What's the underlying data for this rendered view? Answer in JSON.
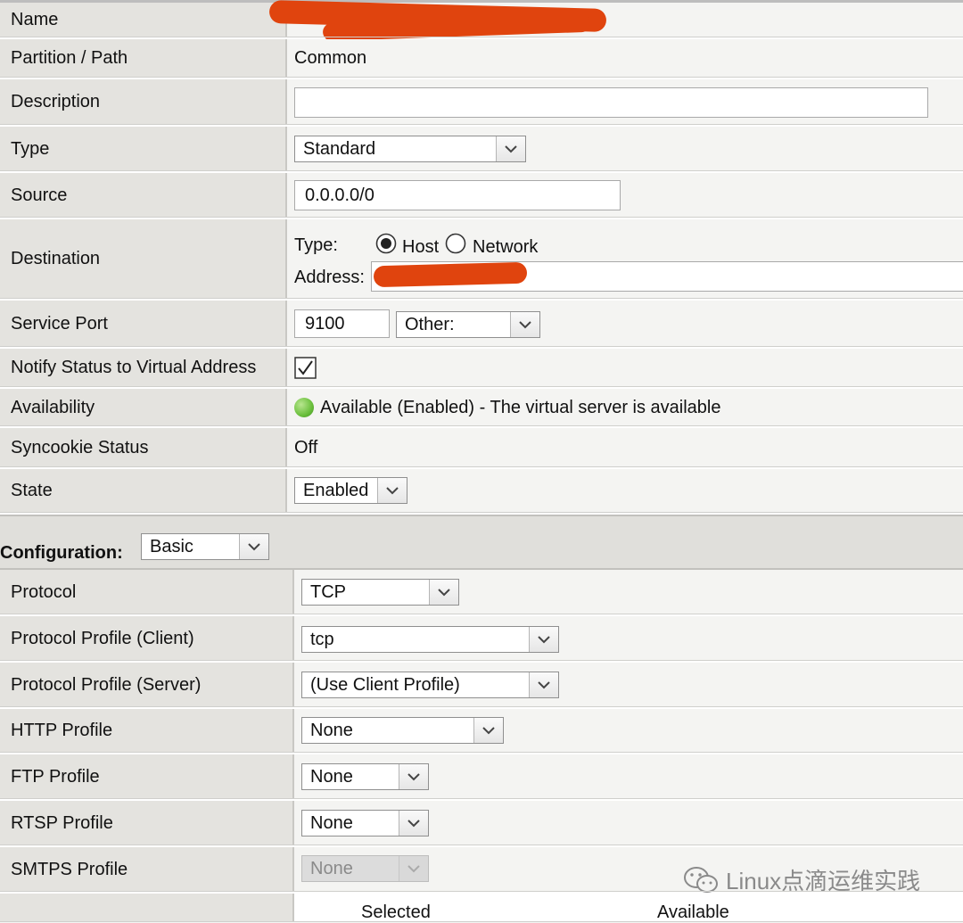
{
  "rows": {
    "name": {
      "label": "Name"
    },
    "partition": {
      "label": "Partition / Path",
      "value": "Common"
    },
    "description": {
      "label": "Description",
      "value": ""
    },
    "type": {
      "label": "Type",
      "value": "Standard"
    },
    "source": {
      "label": "Source",
      "value": "0.0.0.0/0"
    },
    "destination": {
      "label": "Destination",
      "type_label": "Type:",
      "option_host": "Host",
      "option_network": "Network",
      "selected": "Host",
      "address_label": "Address:"
    },
    "service_port": {
      "label": "Service Port",
      "port": "9100",
      "port_select": "Other:"
    },
    "notify": {
      "label": "Notify Status to Virtual Address",
      "checked": true
    },
    "availability": {
      "label": "Availability",
      "value": "Available (Enabled) - The virtual server is available",
      "status_color": "#6abf3c"
    },
    "syncookie": {
      "label": "Syncookie Status",
      "value": "Off"
    },
    "state": {
      "label": "State",
      "value": "Enabled"
    }
  },
  "configuration": {
    "label": "Configuration:",
    "value": "Basic"
  },
  "config_rows": {
    "protocol": {
      "label": "Protocol",
      "value": "TCP"
    },
    "client_profile": {
      "label": "Protocol Profile (Client)",
      "value": "tcp"
    },
    "server_profile": {
      "label": "Protocol Profile (Server)",
      "value": "(Use Client Profile)"
    },
    "http_profile": {
      "label": "HTTP Profile",
      "value": "None"
    },
    "ftp_profile": {
      "label": "FTP Profile",
      "value": "None"
    },
    "rtsp_profile": {
      "label": "RTSP Profile",
      "value": "None"
    },
    "smtps_profile": {
      "label": "SMTPS Profile",
      "value": "None",
      "disabled": true
    }
  },
  "ssl_lists": {
    "selected_header": "Selected",
    "available_header": "Available"
  },
  "watermark": {
    "text": "Linux点滴运维实践"
  },
  "colors": {
    "redaction": "#e0440e",
    "label_bg": "#e4e3df",
    "value_bg": "#f4f4f2"
  }
}
